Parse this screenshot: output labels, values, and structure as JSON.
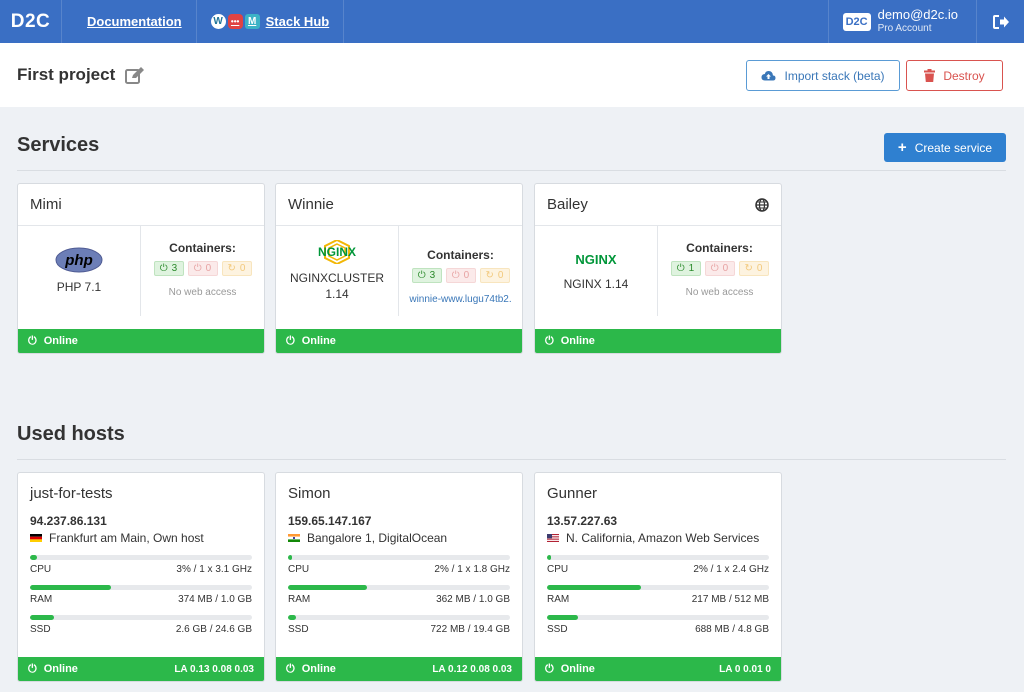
{
  "nav": {
    "logo": "D2C",
    "documentation": "Documentation",
    "stack_hub": "Stack Hub",
    "account_logo": "D2C",
    "account_email": "demo@d2c.io",
    "account_plan": "Pro Account"
  },
  "project": {
    "title": "First project",
    "import_label": "Import stack (beta)",
    "destroy_label": "Destroy"
  },
  "services_section": {
    "title": "Services",
    "create_label": "Create service"
  },
  "services": [
    {
      "name": "Mimi",
      "logo": "php",
      "version": "PHP 7.1",
      "containers_label": "Containers:",
      "running": "3",
      "stopped": "0",
      "restarting": "0",
      "access": "No web access",
      "status": "Online"
    },
    {
      "name": "Winnie",
      "logo": "NGINX",
      "version": "NGINXCLUSTER\n1.14",
      "containers_label": "Containers:",
      "running": "3",
      "stopped": "0",
      "restarting": "0",
      "access": "winnie-www.lugu74tb2.",
      "status": "Online"
    },
    {
      "name": "Bailey",
      "logo": "NGINX",
      "version": "NGINX 1.14",
      "containers_label": "Containers:",
      "running": "1",
      "stopped": "0",
      "restarting": "0",
      "access": "No web access",
      "status": "Online"
    }
  ],
  "hosts_section": {
    "title": "Used hosts"
  },
  "hosts": [
    {
      "name": "just-for-tests",
      "ip": "94.237.86.131",
      "flag": "de",
      "location": "Frankfurt am Main, Own host",
      "cpu_label": "CPU",
      "cpu_value": "3% / 1 x 3.1 GHz",
      "cpu_pct": 0.03,
      "ram_label": "RAM",
      "ram_value": "374 MB / 1.0 GB",
      "ram_pct": 0.365,
      "ssd_label": "SSD",
      "ssd_value": "2.6 GB / 24.6 GB",
      "ssd_pct": 0.106,
      "status": "Online",
      "la": "LA 0.13 0.08 0.03"
    },
    {
      "name": "Simon",
      "ip": "159.65.147.167",
      "flag": "in",
      "location": "Bangalore 1, DigitalOcean",
      "cpu_label": "CPU",
      "cpu_value": "2% / 1 x 1.8 GHz",
      "cpu_pct": 0.02,
      "ram_label": "RAM",
      "ram_value": "362 MB / 1.0 GB",
      "ram_pct": 0.354,
      "ssd_label": "SSD",
      "ssd_value": "722 MB / 19.4 GB",
      "ssd_pct": 0.036,
      "status": "Online",
      "la": "LA 0.12 0.08 0.03"
    },
    {
      "name": "Gunner",
      "ip": "13.57.227.63",
      "flag": "us",
      "location": "N. California, Amazon Web Services",
      "cpu_label": "CPU",
      "cpu_value": "2% / 1 x 2.4 GHz",
      "cpu_pct": 0.02,
      "ram_label": "RAM",
      "ram_value": "217 MB / 512 MB",
      "ram_pct": 0.424,
      "ssd_label": "SSD",
      "ssd_value": "688 MB / 4.8 GB",
      "ssd_pct": 0.14,
      "status": "Online",
      "la": "LA 0 0.01 0"
    }
  ],
  "colors": {
    "nav": "#3a6fc4",
    "online": "#2cb84a",
    "primary": "#2f80d0",
    "danger": "#d9534f"
  },
  "icons": {
    "edit": "edit-icon",
    "cloud_upload": "cloud-upload-icon",
    "trash": "trash-icon",
    "plus": "plus-icon",
    "power": "power-icon",
    "globe": "globe-icon",
    "logout": "logout-icon",
    "refresh": "refresh-icon"
  }
}
